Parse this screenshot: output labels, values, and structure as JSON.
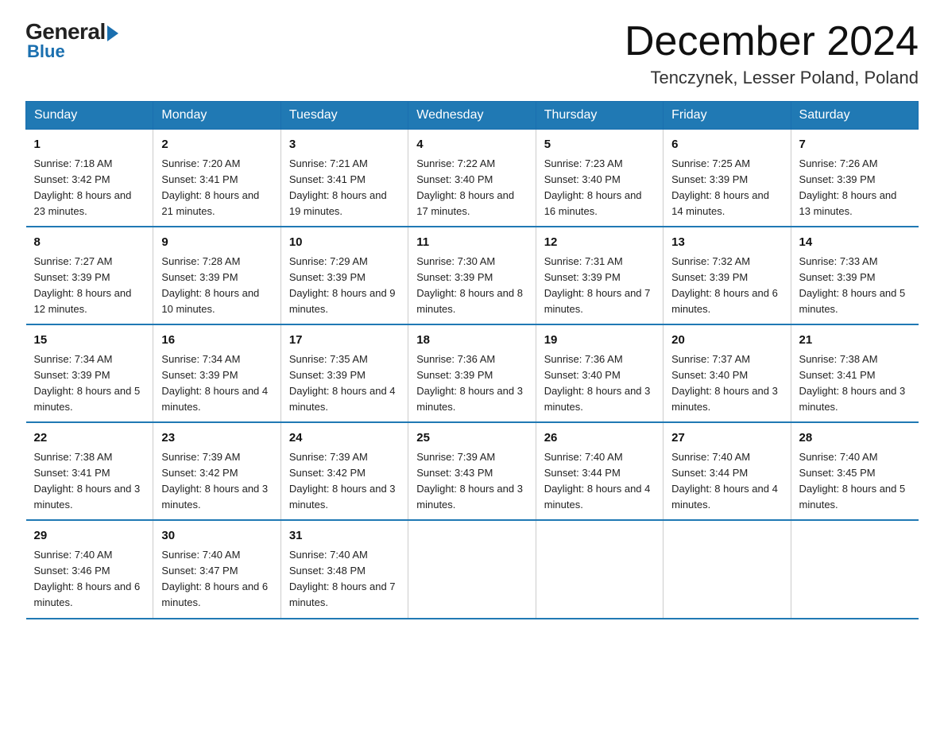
{
  "logo": {
    "general": "General",
    "blue": "Blue"
  },
  "header": {
    "month": "December 2024",
    "subtitle": "Tenczynek, Lesser Poland, Poland"
  },
  "days_of_week": [
    "Sunday",
    "Monday",
    "Tuesday",
    "Wednesday",
    "Thursday",
    "Friday",
    "Saturday"
  ],
  "weeks": [
    [
      {
        "day": "1",
        "sunrise": "7:18 AM",
        "sunset": "3:42 PM",
        "daylight": "8 hours and 23 minutes."
      },
      {
        "day": "2",
        "sunrise": "7:20 AM",
        "sunset": "3:41 PM",
        "daylight": "8 hours and 21 minutes."
      },
      {
        "day": "3",
        "sunrise": "7:21 AM",
        "sunset": "3:41 PM",
        "daylight": "8 hours and 19 minutes."
      },
      {
        "day": "4",
        "sunrise": "7:22 AM",
        "sunset": "3:40 PM",
        "daylight": "8 hours and 17 minutes."
      },
      {
        "day": "5",
        "sunrise": "7:23 AM",
        "sunset": "3:40 PM",
        "daylight": "8 hours and 16 minutes."
      },
      {
        "day": "6",
        "sunrise": "7:25 AM",
        "sunset": "3:39 PM",
        "daylight": "8 hours and 14 minutes."
      },
      {
        "day": "7",
        "sunrise": "7:26 AM",
        "sunset": "3:39 PM",
        "daylight": "8 hours and 13 minutes."
      }
    ],
    [
      {
        "day": "8",
        "sunrise": "7:27 AM",
        "sunset": "3:39 PM",
        "daylight": "8 hours and 12 minutes."
      },
      {
        "day": "9",
        "sunrise": "7:28 AM",
        "sunset": "3:39 PM",
        "daylight": "8 hours and 10 minutes."
      },
      {
        "day": "10",
        "sunrise": "7:29 AM",
        "sunset": "3:39 PM",
        "daylight": "8 hours and 9 minutes."
      },
      {
        "day": "11",
        "sunrise": "7:30 AM",
        "sunset": "3:39 PM",
        "daylight": "8 hours and 8 minutes."
      },
      {
        "day": "12",
        "sunrise": "7:31 AM",
        "sunset": "3:39 PM",
        "daylight": "8 hours and 7 minutes."
      },
      {
        "day": "13",
        "sunrise": "7:32 AM",
        "sunset": "3:39 PM",
        "daylight": "8 hours and 6 minutes."
      },
      {
        "day": "14",
        "sunrise": "7:33 AM",
        "sunset": "3:39 PM",
        "daylight": "8 hours and 5 minutes."
      }
    ],
    [
      {
        "day": "15",
        "sunrise": "7:34 AM",
        "sunset": "3:39 PM",
        "daylight": "8 hours and 5 minutes."
      },
      {
        "day": "16",
        "sunrise": "7:34 AM",
        "sunset": "3:39 PM",
        "daylight": "8 hours and 4 minutes."
      },
      {
        "day": "17",
        "sunrise": "7:35 AM",
        "sunset": "3:39 PM",
        "daylight": "8 hours and 4 minutes."
      },
      {
        "day": "18",
        "sunrise": "7:36 AM",
        "sunset": "3:39 PM",
        "daylight": "8 hours and 3 minutes."
      },
      {
        "day": "19",
        "sunrise": "7:36 AM",
        "sunset": "3:40 PM",
        "daylight": "8 hours and 3 minutes."
      },
      {
        "day": "20",
        "sunrise": "7:37 AM",
        "sunset": "3:40 PM",
        "daylight": "8 hours and 3 minutes."
      },
      {
        "day": "21",
        "sunrise": "7:38 AM",
        "sunset": "3:41 PM",
        "daylight": "8 hours and 3 minutes."
      }
    ],
    [
      {
        "day": "22",
        "sunrise": "7:38 AM",
        "sunset": "3:41 PM",
        "daylight": "8 hours and 3 minutes."
      },
      {
        "day": "23",
        "sunrise": "7:39 AM",
        "sunset": "3:42 PM",
        "daylight": "8 hours and 3 minutes."
      },
      {
        "day": "24",
        "sunrise": "7:39 AM",
        "sunset": "3:42 PM",
        "daylight": "8 hours and 3 minutes."
      },
      {
        "day": "25",
        "sunrise": "7:39 AM",
        "sunset": "3:43 PM",
        "daylight": "8 hours and 3 minutes."
      },
      {
        "day": "26",
        "sunrise": "7:40 AM",
        "sunset": "3:44 PM",
        "daylight": "8 hours and 4 minutes."
      },
      {
        "day": "27",
        "sunrise": "7:40 AM",
        "sunset": "3:44 PM",
        "daylight": "8 hours and 4 minutes."
      },
      {
        "day": "28",
        "sunrise": "7:40 AM",
        "sunset": "3:45 PM",
        "daylight": "8 hours and 5 minutes."
      }
    ],
    [
      {
        "day": "29",
        "sunrise": "7:40 AM",
        "sunset": "3:46 PM",
        "daylight": "8 hours and 6 minutes."
      },
      {
        "day": "30",
        "sunrise": "7:40 AM",
        "sunset": "3:47 PM",
        "daylight": "8 hours and 6 minutes."
      },
      {
        "day": "31",
        "sunrise": "7:40 AM",
        "sunset": "3:48 PM",
        "daylight": "8 hours and 7 minutes."
      },
      null,
      null,
      null,
      null
    ]
  ]
}
